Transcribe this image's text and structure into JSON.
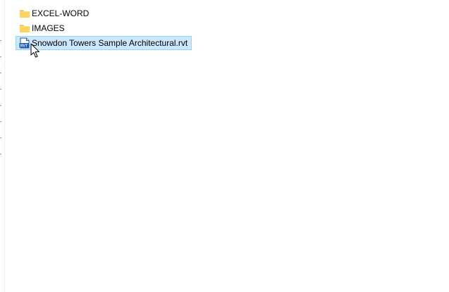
{
  "files": [
    {
      "name": "EXCEL-WORD",
      "icon": "folder-icon",
      "selected": false
    },
    {
      "name": "IMAGES",
      "icon": "folder-icon",
      "selected": false
    },
    {
      "name": "Snowdon Towers Sample Architectural.rvt",
      "icon": "rvt-file-icon",
      "icon_text": "RVT",
      "selected": true
    }
  ],
  "colors": {
    "selection_bg": "#cce8ff",
    "selection_border": "#99d1ff",
    "folder_yellow": "#ffd45e",
    "rvt_blue": "#1f5aa8"
  }
}
